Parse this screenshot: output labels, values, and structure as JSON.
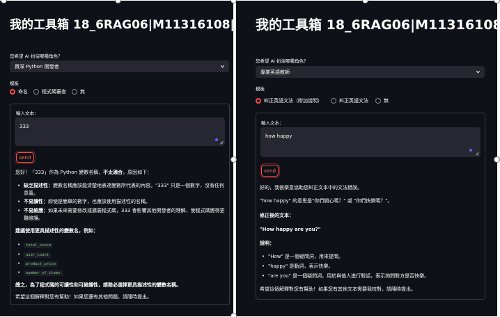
{
  "left": {
    "title": "我的工具箱 18_6RAG06|M11316108|",
    "role_label": "您希望 AI 扮演哪種角色？",
    "role_value": "資深 Python 開發者",
    "template_label": "模板",
    "radios": [
      "命名",
      "程式碼審查",
      "無"
    ],
    "input_label": "輸入文本：",
    "input_value": "333",
    "send_label": "send",
    "resp_intro_a": "您好！「333」作為 Python 變數名稱，",
    "resp_intro_b": "不太適合",
    "resp_intro_c": "，原因如下：",
    "b1_title": "缺乏描述性：",
    "b1_text": "變數名稱應該能清楚地表達變數所代表的內容。\"333\" 只是一個數字，沒有任何意義。",
    "b2_title": "不易讀性：",
    "b2_text": "即使是簡單的數字，也應該使用描述性的名稱。",
    "b3_title": "不易維護：",
    "b3_text": "如果未來需要修改或擴展程式碼，333 會影響其他開發者的理解，使程式碼變得更難維護。",
    "suggest_heading": "建議使用更具描述性的變數名，例如：",
    "codes": [
      "total_score",
      "user_count",
      "product_price",
      "number_of_items"
    ],
    "summary": "總之，為了程式碼的可讀性和可維護性，請務必選擇更具描述性的變數名稱。",
    "closing": "希望這個解釋對您有幫助！如果您還有其他問題，請隨時提出。"
  },
  "right": {
    "title": "我的工具箱 18_6RAG06|M11316108|",
    "role_label": "您希望 AI 扮演哪種角色？",
    "role_value": "專業英語教師",
    "template_label": "模板",
    "radios": [
      "糾正英語文法（附加說明）",
      "糾正英語文法",
      "無"
    ],
    "input_label": "輸入文本：",
    "input_value": "how happy",
    "send_label": "send",
    "p1": "好的，我很樂意協助您糾正文本中的文法錯誤。",
    "p2": "\"how happy\" 的意思是\"你們開心嗎？\" 或 \"你們快樂嗎？\"。",
    "fixed_label": "修正後的文本：",
    "fixed_text": "\"How happy are you?\"",
    "explain_label": "說明：",
    "b1": "\"How\" 是一個疑問詞，用來提問。",
    "b2": "\"happy\" 是動詞，表示快樂。",
    "b3": "\"are you\" 是一個疑問詞，用於與他人進行對話，表示詢問對方是否快樂。",
    "closing": "希望這個解釋對您有幫助！如果您有其他文本需要我校對，請隨時提出。"
  },
  "colors": {
    "bg": "#0e1117",
    "accent": "#ff4b4b",
    "input_bg": "#262730"
  },
  "icons": [
    "chevron-down-icon",
    "resize-handle-icon",
    "radio-icon"
  ]
}
